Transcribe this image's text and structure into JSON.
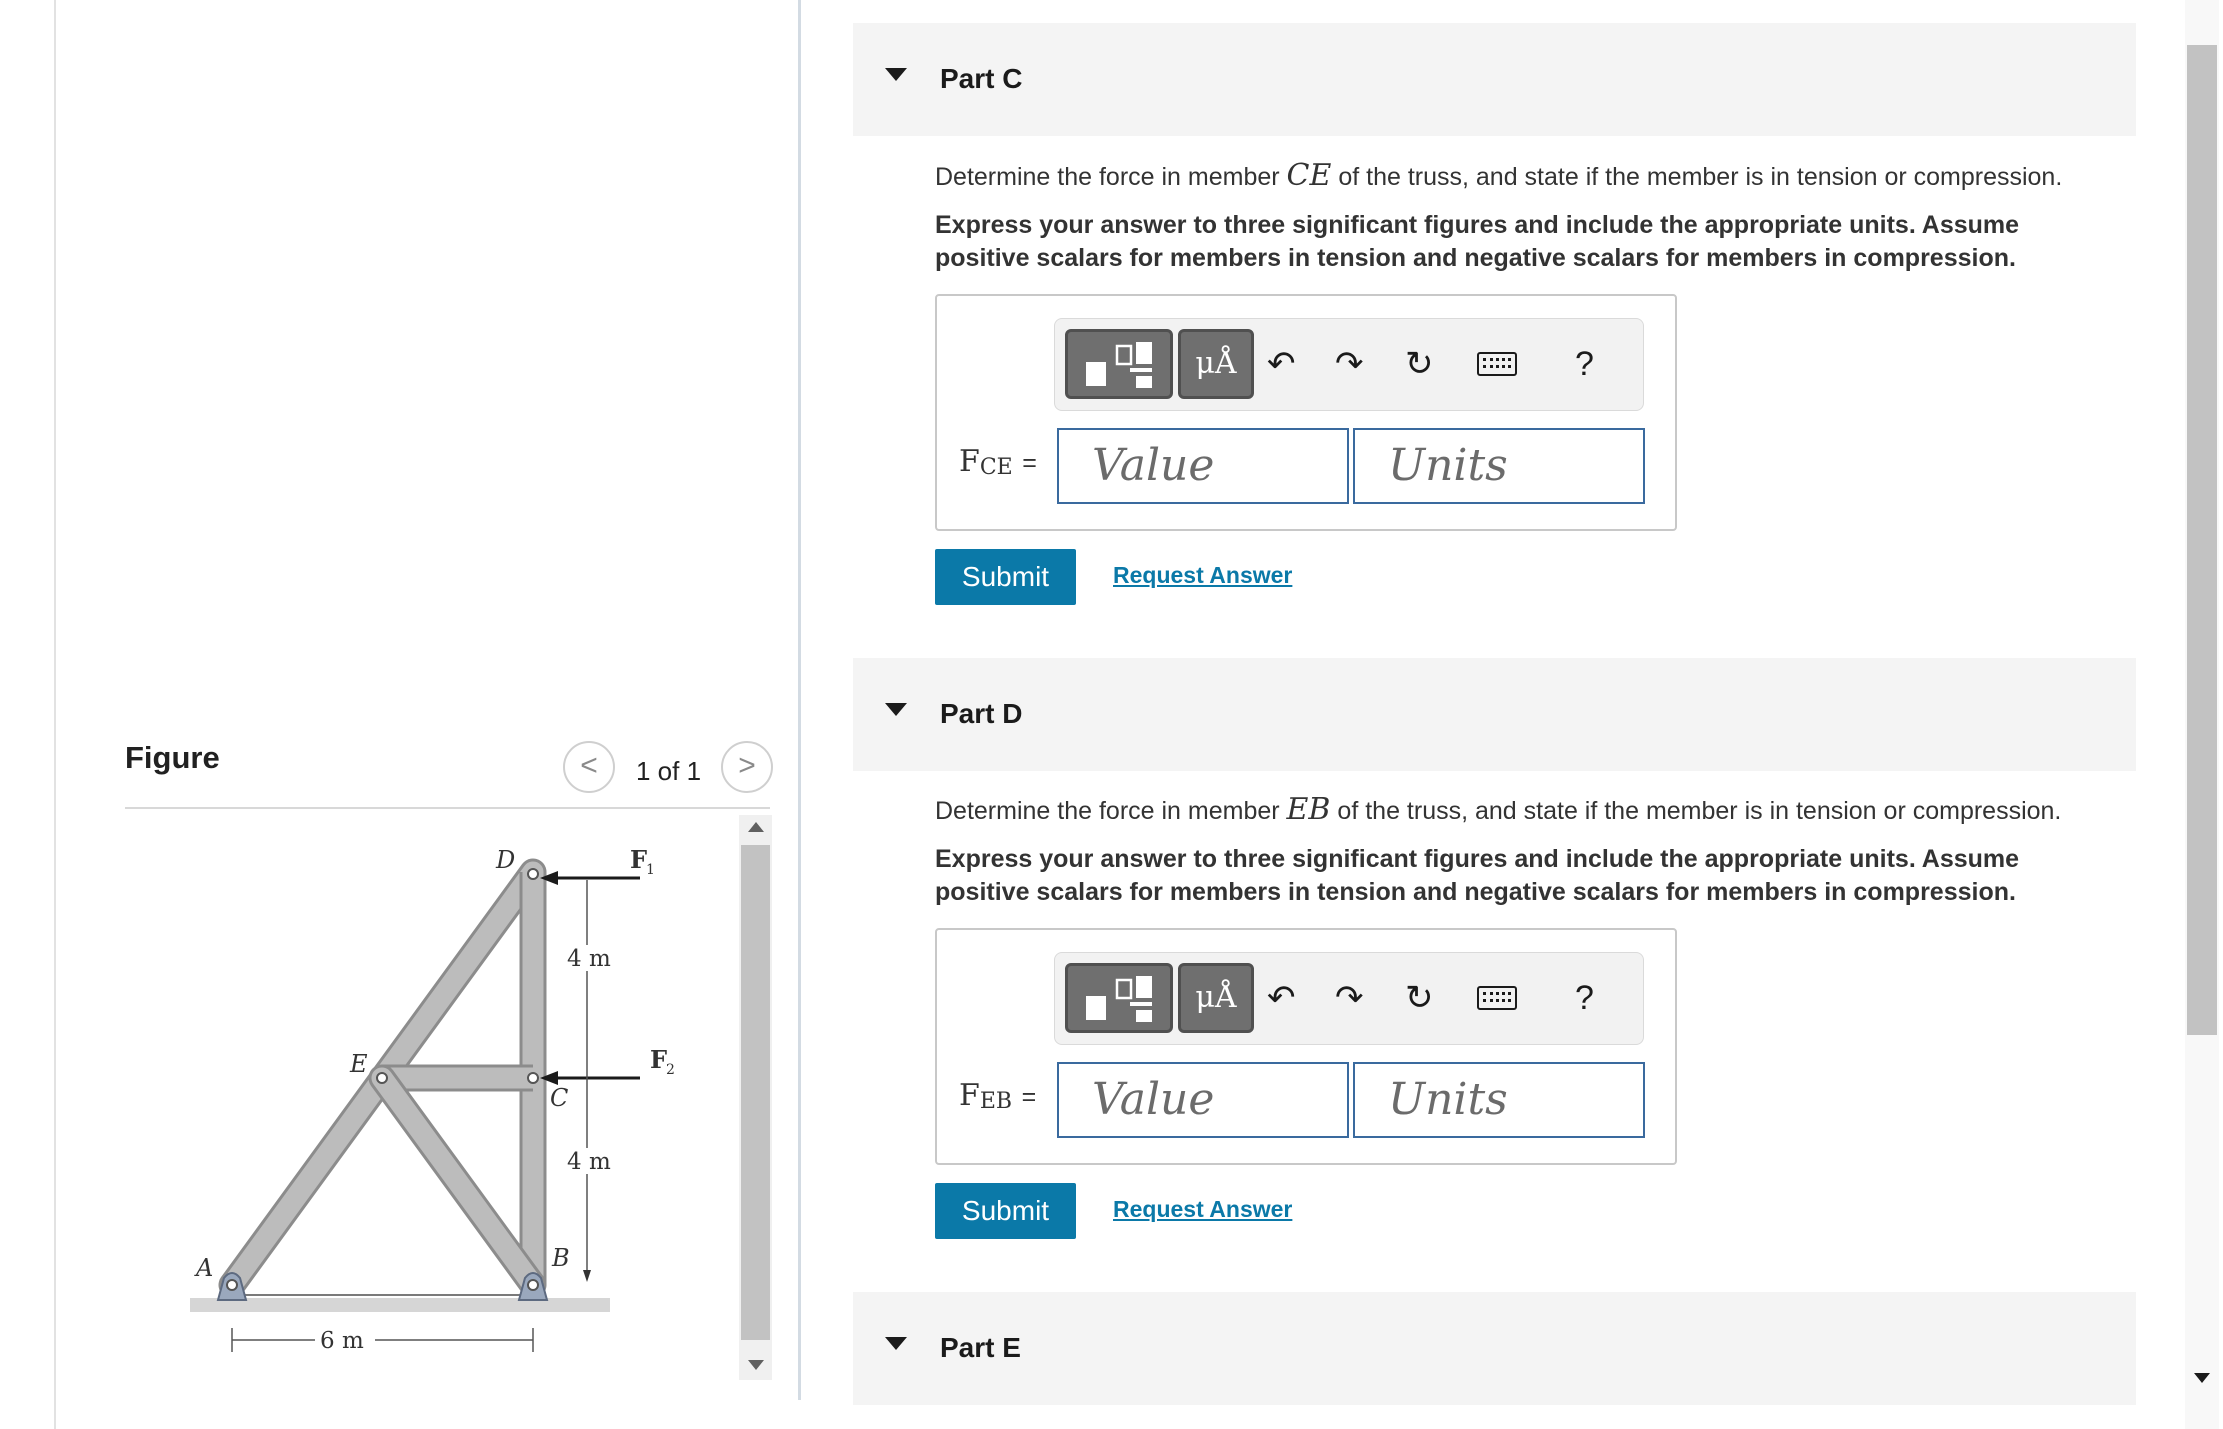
{
  "figure": {
    "title": "Figure",
    "page_count": "1 of 1",
    "prev_glyph": "<",
    "next_glyph": ">",
    "labels": {
      "D": "D",
      "E": "E",
      "C": "C",
      "B": "B",
      "A": "A",
      "F1": "F",
      "F1_sub": "1",
      "F2": "F",
      "F2_sub": "2",
      "dim_top": "4 m",
      "dim_mid": "4 m",
      "dim_base": "6 m"
    }
  },
  "parts": [
    {
      "label": "Part C",
      "prompt_pre": "Determine the force in member ",
      "member": "CE",
      "prompt_post": " of the truss, and state if the member is in tension or compression.",
      "instructions": "Express your answer to three significant figures and include the appropriate units. Assume positive scalars for members in tension and negative scalars for members in compression.",
      "eq_var": "F",
      "eq_sub": "CE",
      "eq_sign": "=",
      "value_placeholder": "Value",
      "units_placeholder": "Units",
      "submit": "Submit",
      "request": "Request Answer"
    },
    {
      "label": "Part D",
      "prompt_pre": "Determine the force in member ",
      "member": "EB",
      "prompt_post": " of the truss, and state if the member is in tension or compression.",
      "instructions": "Express your answer to three significant figures and include the appropriate units. Assume positive scalars for members in tension and negative scalars for members in compression.",
      "eq_var": "F",
      "eq_sub": "EB",
      "eq_sign": "=",
      "value_placeholder": "Value",
      "units_placeholder": "Units",
      "submit": "Submit",
      "request": "Request Answer"
    },
    {
      "label": "Part E"
    }
  ],
  "toolbar": {
    "units_glyph": "μÅ",
    "undo_icon": "undo-icon",
    "redo_icon": "redo-icon",
    "reset_icon": "reset-icon",
    "keyboard_icon": "keyboard-icon",
    "help_glyph": "?"
  },
  "colors": {
    "accent": "#0b79a8",
    "field_border": "#3a6a9e",
    "header_bg": "#f4f4f4",
    "truss_member": "#b4b4b4"
  }
}
